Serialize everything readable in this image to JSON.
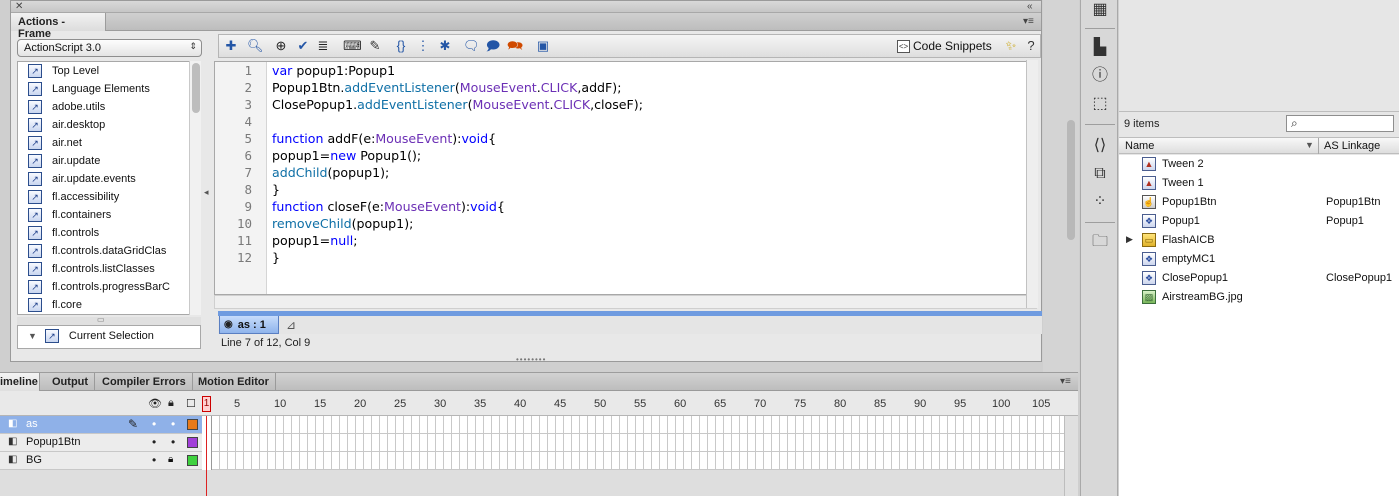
{
  "actions_panel": {
    "title": "Actions - Frame",
    "version_select": "ActionScript 3.0",
    "tree_items": [
      "Top Level",
      "Language Elements",
      "adobe.utils",
      "air.desktop",
      "air.net",
      "air.update",
      "air.update.events",
      "fl.accessibility",
      "fl.containers",
      "fl.controls",
      "fl.controls.dataGridClas",
      "fl.controls.listClasses",
      "fl.controls.progressBarC",
      "fl.core"
    ],
    "current_selection_label": "Current Selection",
    "code_snippets_label": "Code Snippets",
    "line_numbers": [
      "1",
      "2",
      "3",
      "4",
      "5",
      "6",
      "7",
      "8",
      "9",
      "10",
      "11",
      "12"
    ],
    "script_tab_label": "as : 1",
    "status_text": "Line 7 of 12, Col 9"
  },
  "library": {
    "item_count": "9 items",
    "col_name": "Name",
    "col_linkage": "AS Linkage",
    "items": [
      {
        "name": "Tween 2",
        "linkage": ""
      },
      {
        "name": "Tween 1",
        "linkage": ""
      },
      {
        "name": "Popup1Btn",
        "linkage": "Popup1Btn"
      },
      {
        "name": "Popup1",
        "linkage": "Popup1"
      },
      {
        "name": "FlashAICB",
        "linkage": ""
      },
      {
        "name": "emptyMC1",
        "linkage": ""
      },
      {
        "name": "ClosePopup1",
        "linkage": "ClosePopup1"
      },
      {
        "name": "AirstreamBG.jpg",
        "linkage": ""
      }
    ]
  },
  "timeline": {
    "tabs": [
      "imeline",
      "Output",
      "Compiler Errors",
      "Motion Editor"
    ],
    "frame_numbers": [
      "1",
      "5",
      "10",
      "15",
      "20",
      "25",
      "30",
      "35",
      "40",
      "45",
      "50",
      "55",
      "60",
      "65",
      "70",
      "75",
      "80",
      "85",
      "90",
      "95",
      "100",
      "105"
    ],
    "layers": [
      {
        "name": "as",
        "color": "#e87a1a"
      },
      {
        "name": "Popup1Btn",
        "color": "#a13fd8"
      },
      {
        "name": "BG",
        "color": "#3fd13f"
      }
    ]
  }
}
